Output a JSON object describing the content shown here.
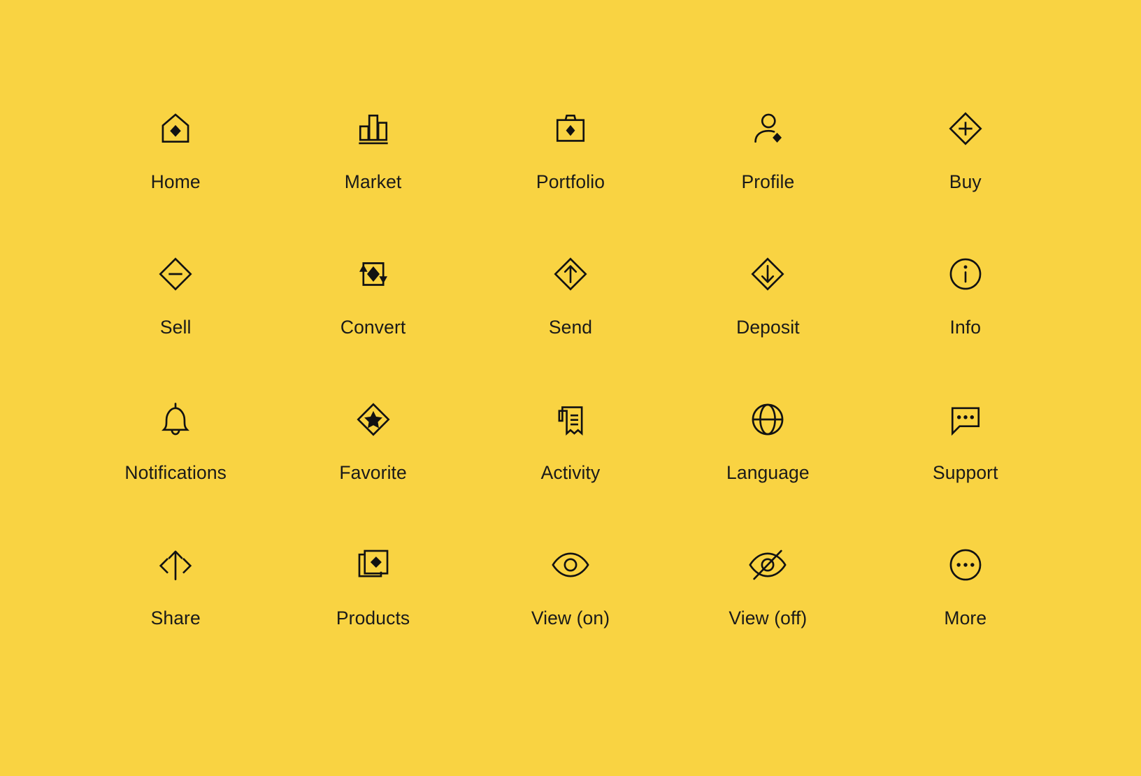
{
  "page": {
    "background_color": "#F9D342",
    "icon_color": "#121212",
    "label_color": "#1a1a1a",
    "columns": 5,
    "rows": 4
  },
  "icons": [
    {
      "label": "Home",
      "icon": "home-icon"
    },
    {
      "label": "Market",
      "icon": "bar-chart-icon"
    },
    {
      "label": "Portfolio",
      "icon": "briefcase-icon"
    },
    {
      "label": "Profile",
      "icon": "user-icon"
    },
    {
      "label": "Buy",
      "icon": "diamond-plus-icon"
    },
    {
      "label": "Sell",
      "icon": "diamond-minus-icon"
    },
    {
      "label": "Convert",
      "icon": "convert-arrows-icon"
    },
    {
      "label": "Send",
      "icon": "diamond-arrow-up-icon"
    },
    {
      "label": "Deposit",
      "icon": "diamond-arrow-down-icon"
    },
    {
      "label": "Info",
      "icon": "info-circle-icon"
    },
    {
      "label": "Notifications",
      "icon": "bell-icon"
    },
    {
      "label": "Favorite",
      "icon": "diamond-star-icon"
    },
    {
      "label": "Activity",
      "icon": "receipt-icon"
    },
    {
      "label": "Language",
      "icon": "globe-icon"
    },
    {
      "label": "Support",
      "icon": "chat-bubble-icon"
    },
    {
      "label": "Share",
      "icon": "share-arrow-icon"
    },
    {
      "label": "Products",
      "icon": "stacked-cards-icon"
    },
    {
      "label": "View (on)",
      "icon": "eye-icon"
    },
    {
      "label": "View (off)",
      "icon": "eye-off-icon"
    },
    {
      "label": "More",
      "icon": "more-dots-icon"
    }
  ]
}
